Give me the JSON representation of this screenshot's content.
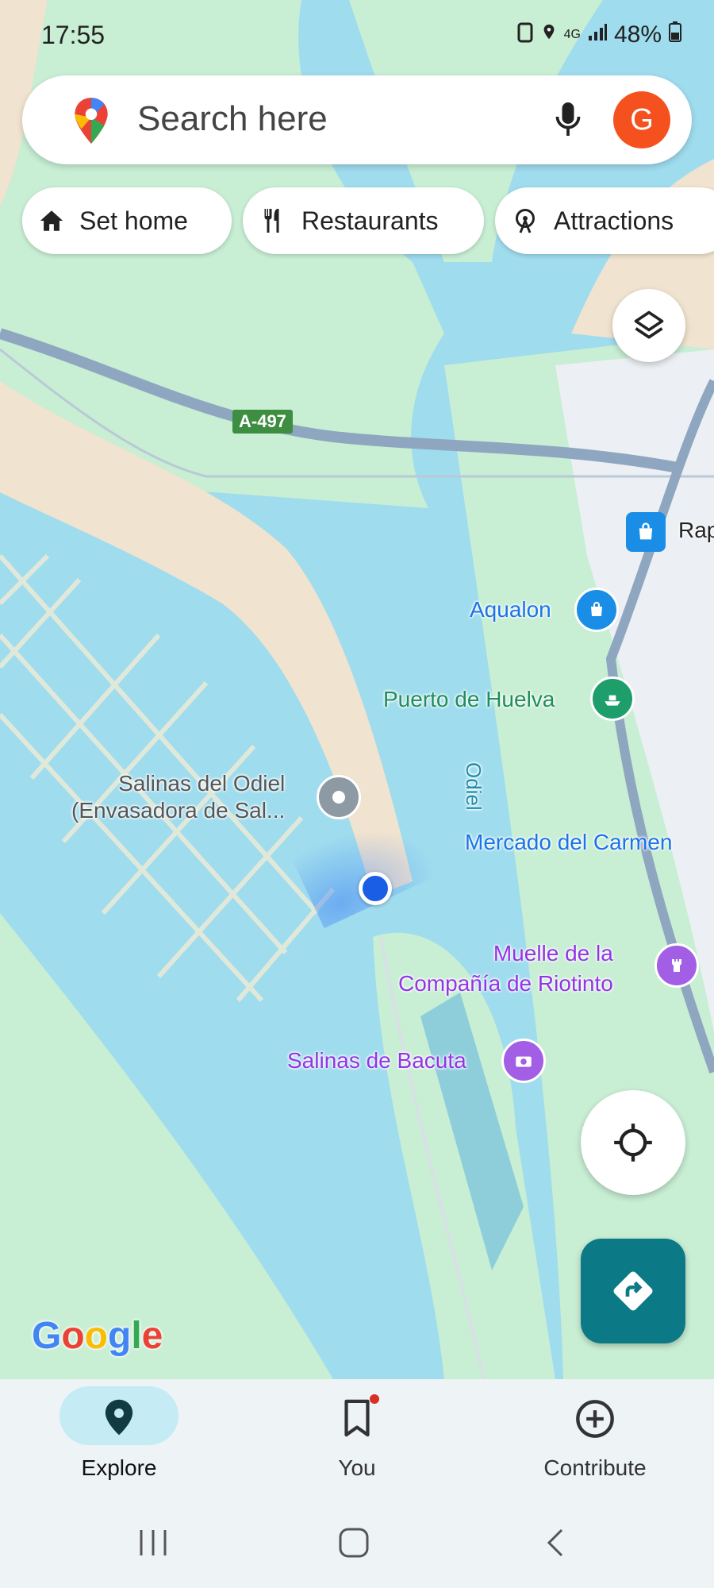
{
  "status": {
    "time": "17:55",
    "network": "4G",
    "battery": "48%"
  },
  "search": {
    "placeholder": "Search here",
    "avatar_letter": "G"
  },
  "chips": [
    {
      "label": "Set home",
      "icon": "home-icon"
    },
    {
      "label": "Restaurants",
      "icon": "fork-knife-icon"
    },
    {
      "label": "Attractions",
      "icon": "ferris-wheel-icon"
    }
  ],
  "map": {
    "road_shield": "A-497",
    "places": {
      "rap": "Rap",
      "aqualon": "Aqualon",
      "puerto": "Puerto de Huelva",
      "odiel": "Odiel",
      "mercado": "Mercado del Carmen",
      "salinas_odiel_1": "Salinas del Odiel",
      "salinas_odiel_2": "(Envasadora de Sal...",
      "muelle_1": "Muelle de la",
      "muelle_2": "Compañía de Riotinto",
      "bacuta": "Salinas de Bacuta"
    },
    "logo": "Google"
  },
  "nav": {
    "explore": "Explore",
    "you": "You",
    "contribute": "Contribute"
  },
  "colors": {
    "water": "#9fdcee",
    "land": "#c8eed4",
    "sand": "#f0e3cf",
    "accent": "#0b7a86",
    "avatar": "#f4511e"
  }
}
